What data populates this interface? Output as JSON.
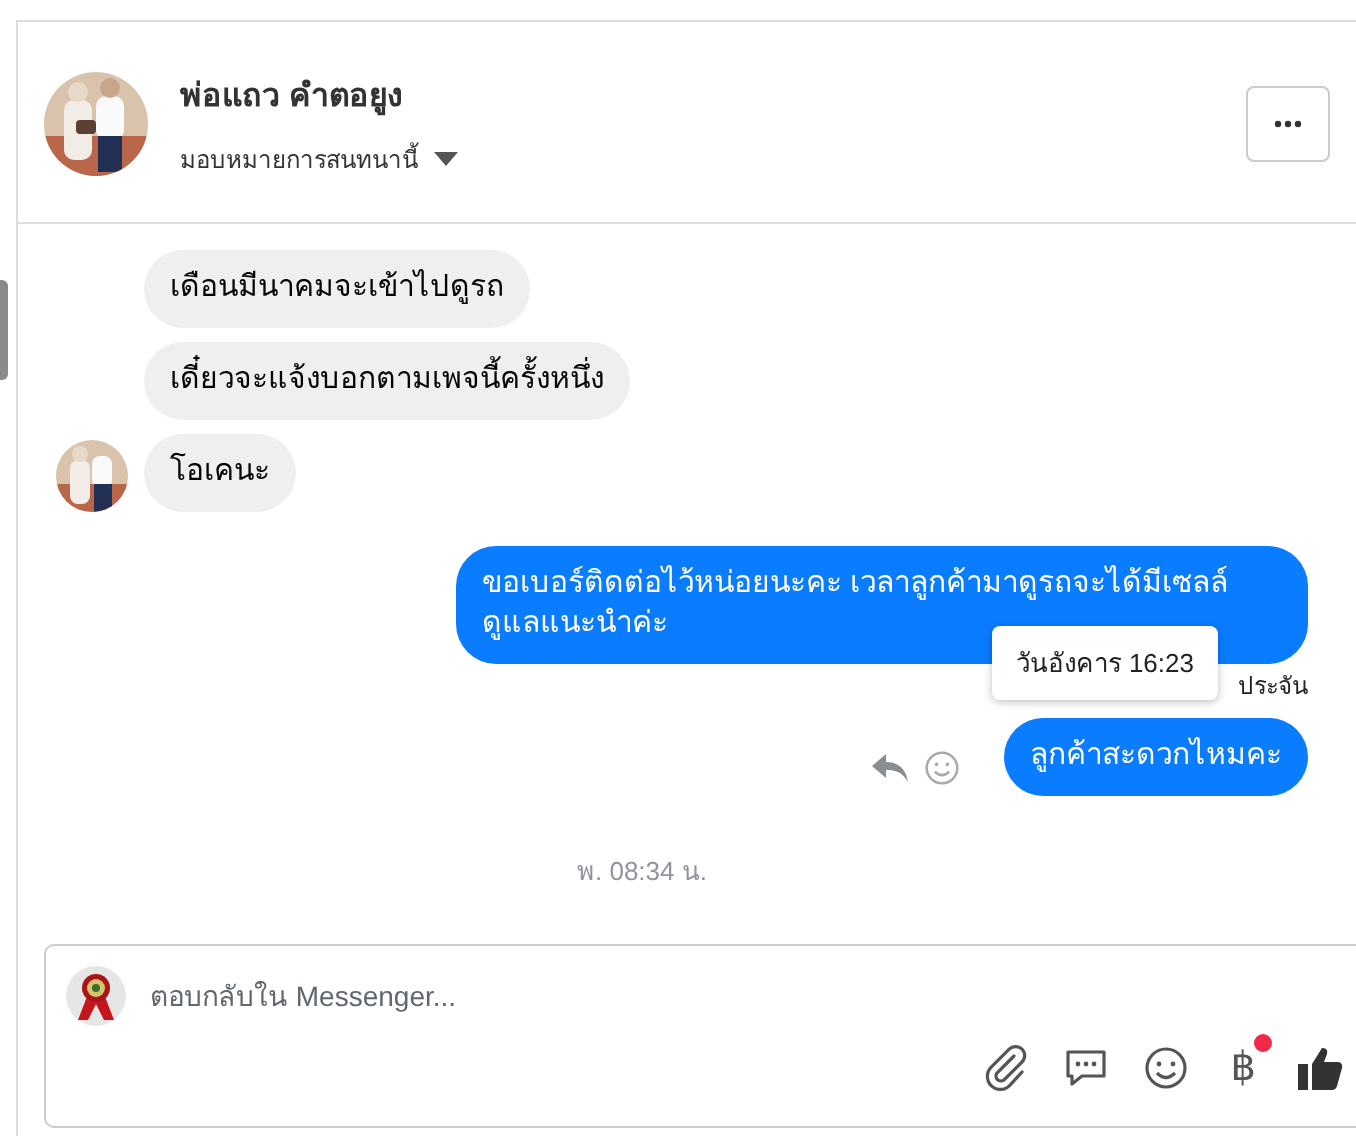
{
  "header": {
    "name": "พ่อแถว คำตอยูง",
    "subtitle": "มอบหมายการสนทนานี้"
  },
  "messages": [
    {
      "kind": "incoming",
      "text": "เดือนมีนาคมจะเข้าไปดูรถ",
      "avatar": false
    },
    {
      "kind": "incoming",
      "text": "เดี๋ยวจะแจ้งบอกตามเพจนี้ครั้งหนึ่ง",
      "avatar": false
    },
    {
      "kind": "incoming",
      "text": "โอเคนะ",
      "avatar": true
    },
    {
      "kind": "outgoing",
      "text": "ขอเบอร์ติดต่อไว้หน่อยนะคะ เวลาลูกค้ามาดูรถจะได้มีเซลล์ดูแลแนะนำค่ะ",
      "tooltip": "วันอังคาร 16:23",
      "note": "ประจัน",
      "actions": false
    },
    {
      "kind": "outgoing",
      "text": "ลูกค้าสะดวกไหมคะ",
      "actions": true
    }
  ],
  "timestamp": "พ. 08:34 น.",
  "composer": {
    "placeholder": "ตอบกลับใน Messenger...",
    "currency": "฿",
    "currency_badge": true
  }
}
